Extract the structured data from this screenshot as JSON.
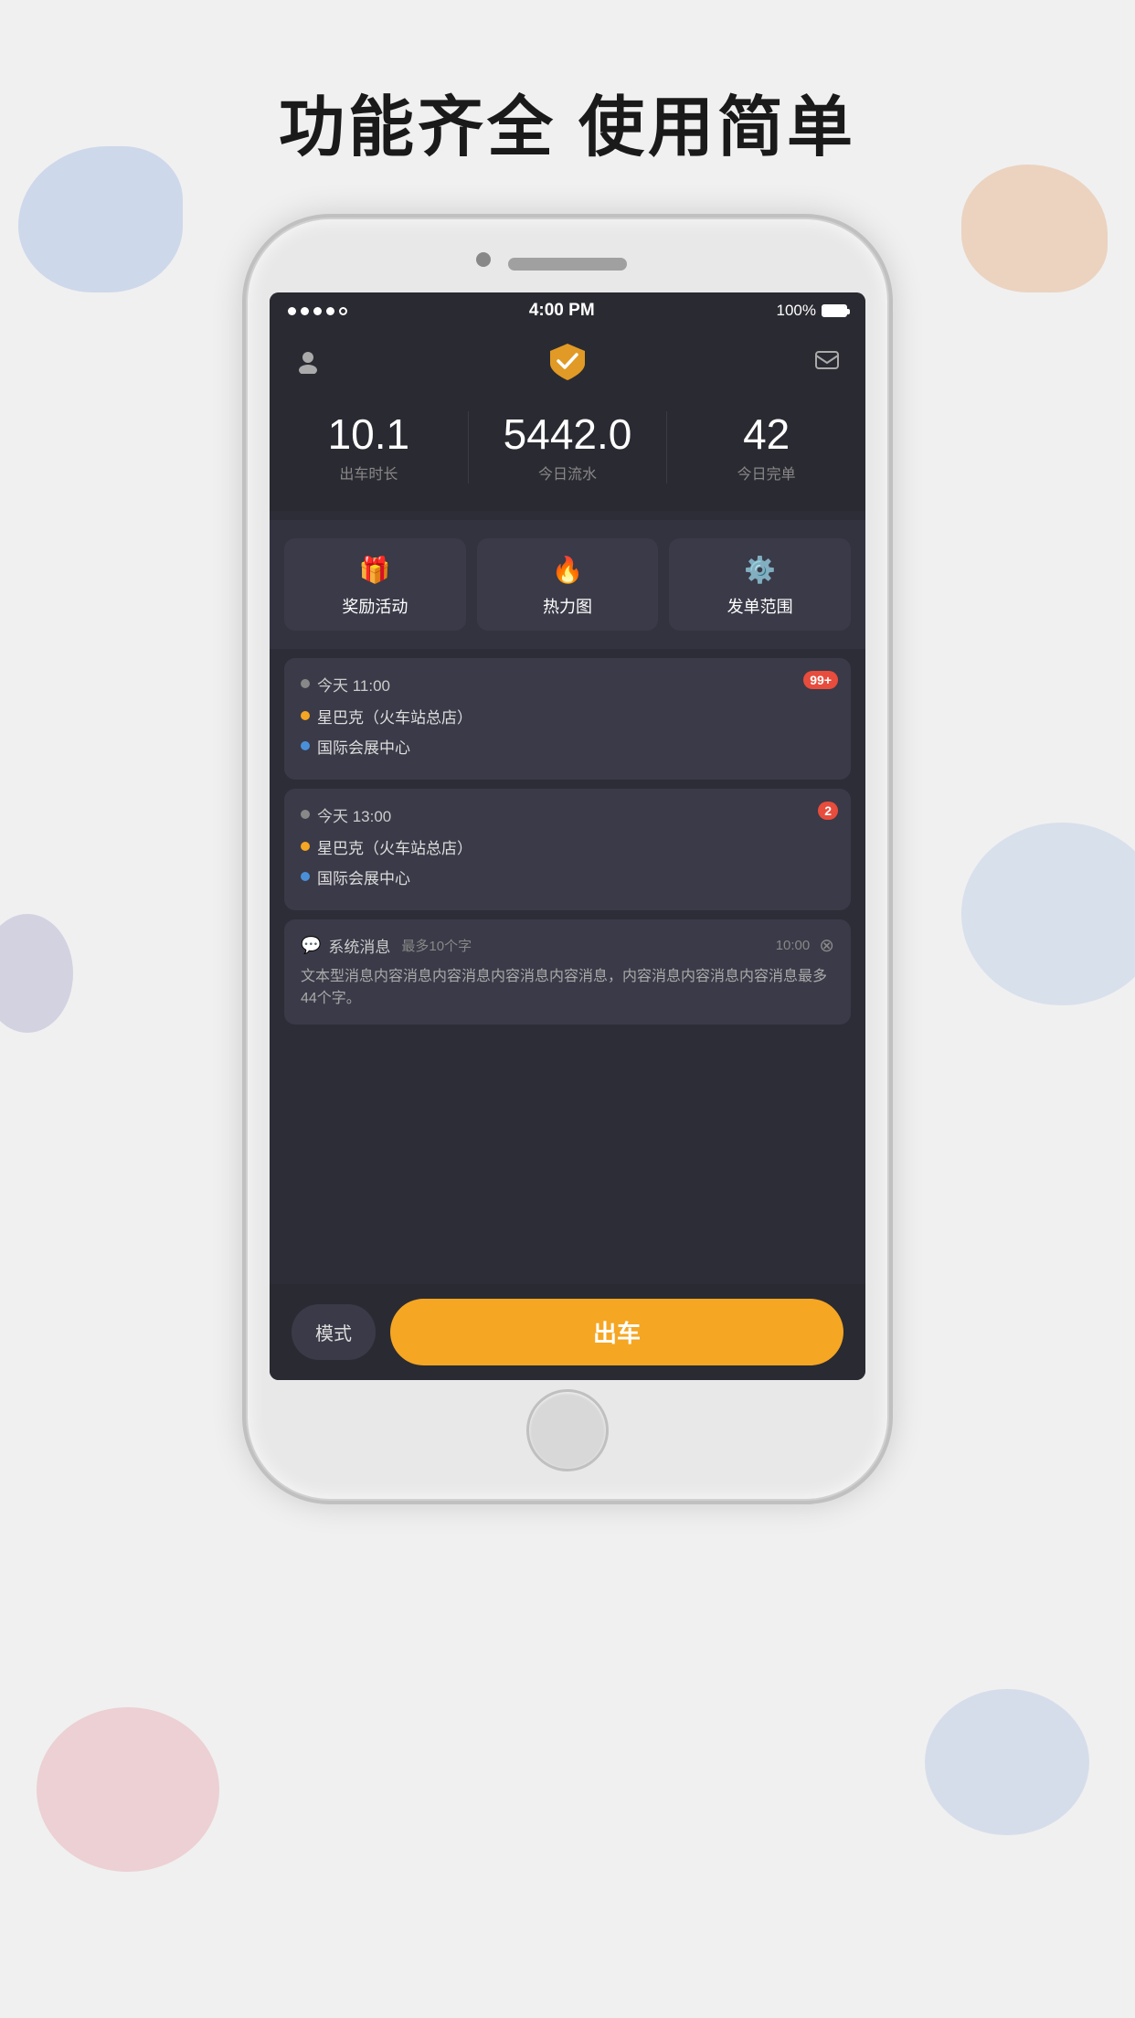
{
  "page": {
    "title": "功能齐全   使用简单"
  },
  "status_bar": {
    "signal": "....○",
    "time": "4:00 PM",
    "battery": "100%"
  },
  "header": {
    "logo_alt": "App Logo"
  },
  "stats": [
    {
      "value": "10.1",
      "label": "出车时长"
    },
    {
      "value": "5442.0",
      "label": "今日流水"
    },
    {
      "value": "42",
      "label": "今日完单"
    }
  ],
  "features": [
    {
      "icon": "🎁",
      "label": "奖励活动"
    },
    {
      "icon": "🔥",
      "label": "热力图"
    },
    {
      "icon": "⚙️",
      "label": "发单范围"
    }
  ],
  "orders": [
    {
      "time": "今天  11:00",
      "pickup": "星巴克（火车站总店）",
      "dropoff": "国际会展中心",
      "badge": "99+"
    },
    {
      "time": "今天  13:00",
      "pickup": "星巴克（火车站总店）",
      "dropoff": "国际会展中心",
      "badge": "2"
    }
  ],
  "notification": {
    "title": "系统消息",
    "subtitle": "最多10个字",
    "time": "10:00",
    "body": "文本型消息内容消息内容消息内容消息内容消息，内容消息内容消息内容消息最多44个字。"
  },
  "bottom_bar": {
    "mode_label": "模式",
    "action_label": "出车"
  }
}
